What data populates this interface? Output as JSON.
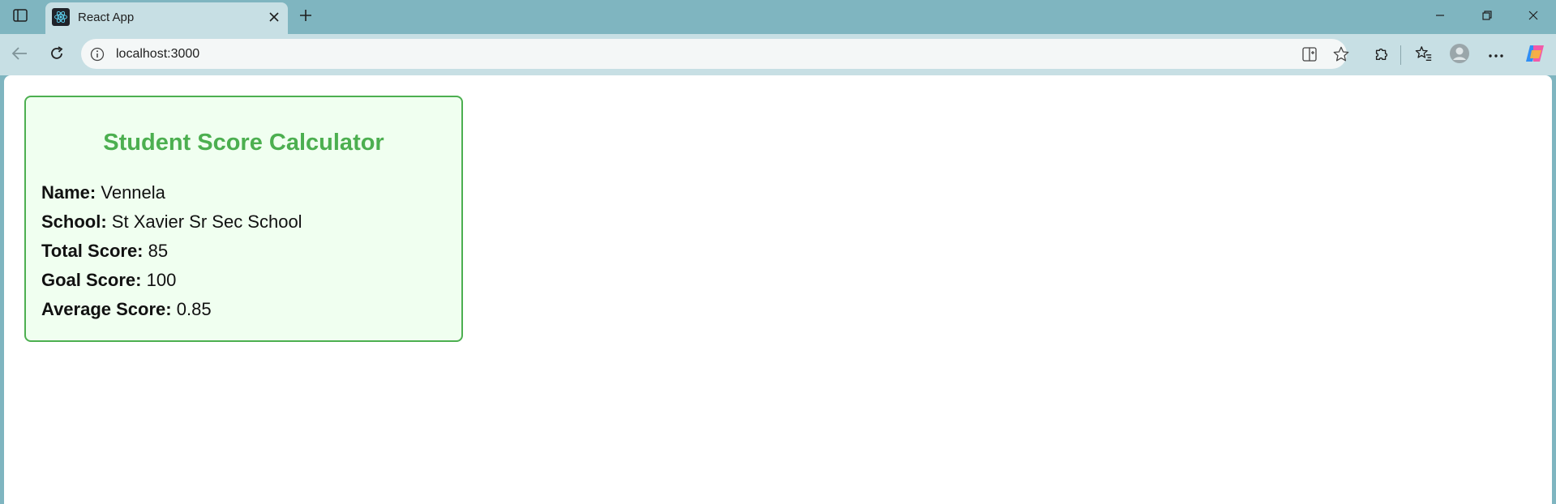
{
  "browser": {
    "tab": {
      "title": "React App"
    },
    "address": {
      "url": "localhost:3000"
    },
    "icons": {
      "sidebar": "sidebar-icon",
      "favicon": "react-icon",
      "close": "close-icon",
      "new_tab": "plus-icon",
      "back": "back-arrow-icon",
      "reload": "reload-icon",
      "info": "info-icon",
      "split": "split-screen-icon",
      "favorite": "star-icon",
      "extensions": "puzzle-icon",
      "favorites": "favorites-icon",
      "profile": "profile-icon",
      "more": "more-icon",
      "copilot": "copilot-icon"
    }
  },
  "app": {
    "title": "Student Score Calculator",
    "rows": [
      {
        "label": "Name:",
        "value": "Vennela"
      },
      {
        "label": "School:",
        "value": "St Xavier Sr Sec School"
      },
      {
        "label": "Total Score:",
        "value": "85"
      },
      {
        "label": "Goal Score:",
        "value": "100"
      },
      {
        "label": "Average Score:",
        "value": "0.85"
      }
    ]
  },
  "colors": {
    "accent": "#4caf50",
    "card_bg": "#f0fff0",
    "chrome": "#7fb5c0",
    "toolbar": "#c7dfe4"
  }
}
